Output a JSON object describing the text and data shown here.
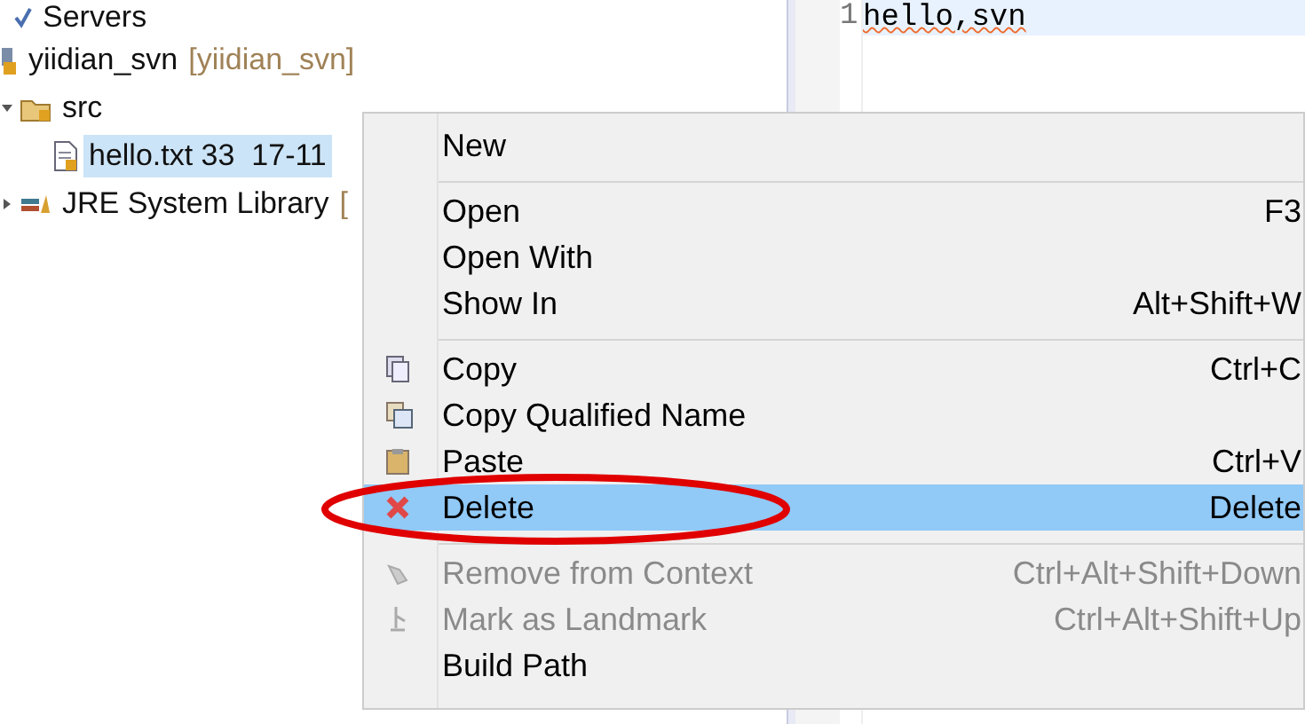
{
  "tree": [
    {
      "label": "Servers",
      "kind": "server"
    },
    {
      "label": "yiidian_svn",
      "decoration": "[yiidian_svn]",
      "kind": "project",
      "children": [
        {
          "label": "src",
          "kind": "folder",
          "expanded": true,
          "selected": false,
          "children": [
            {
              "label": "hello.txt 33  17-11",
              "kind": "file",
              "selected": true
            }
          ]
        },
        {
          "label": "JRE System Library",
          "decoration": "[",
          "kind": "library",
          "expanded": false,
          "selected": false
        }
      ]
    }
  ],
  "editor": {
    "line_number": "1",
    "text": "hello,svn"
  },
  "menu": [
    {
      "kind": "plain",
      "label": "New"
    },
    {
      "kind": "separator"
    },
    {
      "kind": "plain",
      "label": "Open",
      "shortcut": "F3"
    },
    {
      "kind": "plain",
      "label": "Open With"
    },
    {
      "kind": "plain",
      "label": "Show In",
      "shortcut": "Alt+Shift+W"
    },
    {
      "kind": "separator"
    },
    {
      "kind": "copy",
      "label": "Copy",
      "shortcut": "Ctrl+C"
    },
    {
      "kind": "copy-names",
      "label": "Copy Qualified Name"
    },
    {
      "kind": "paste",
      "label": "Paste",
      "shortcut": "Ctrl+V"
    },
    {
      "kind": "delete",
      "label": "Delete",
      "shortcut": "Delete",
      "selected": true
    },
    {
      "kind": "separator"
    },
    {
      "kind": "remove",
      "label": "Remove from Context",
      "shortcut": "Ctrl+Alt+Shift+Down",
      "disabled": true
    },
    {
      "kind": "landmark",
      "label": "Mark as Landmark",
      "shortcut": "Ctrl+Alt+Shift+Up",
      "disabled": true
    },
    {
      "kind": "plain",
      "label": "Build Path"
    }
  ]
}
